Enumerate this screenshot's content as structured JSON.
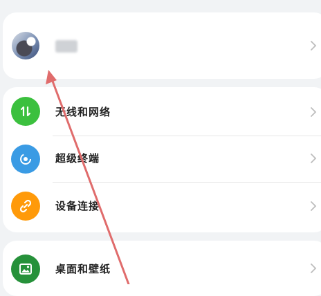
{
  "account": {
    "name_redacted": true
  },
  "settings": {
    "wlan": {
      "label": "无线和网络",
      "icon": "wifi-arrows-icon",
      "color": "#3bc03e"
    },
    "super": {
      "label": "超级终端",
      "icon": "super-device-icon",
      "color": "#3a9be4"
    },
    "connect": {
      "label": "设备连接",
      "icon": "link-icon",
      "color": "#ff9a0a"
    },
    "desktop": {
      "label": "桌面和壁纸",
      "icon": "wallpaper-icon",
      "color": "#26913a"
    }
  },
  "annotation": {
    "type": "red-arrow-pointing-to-account",
    "color": "#e06c6c"
  }
}
